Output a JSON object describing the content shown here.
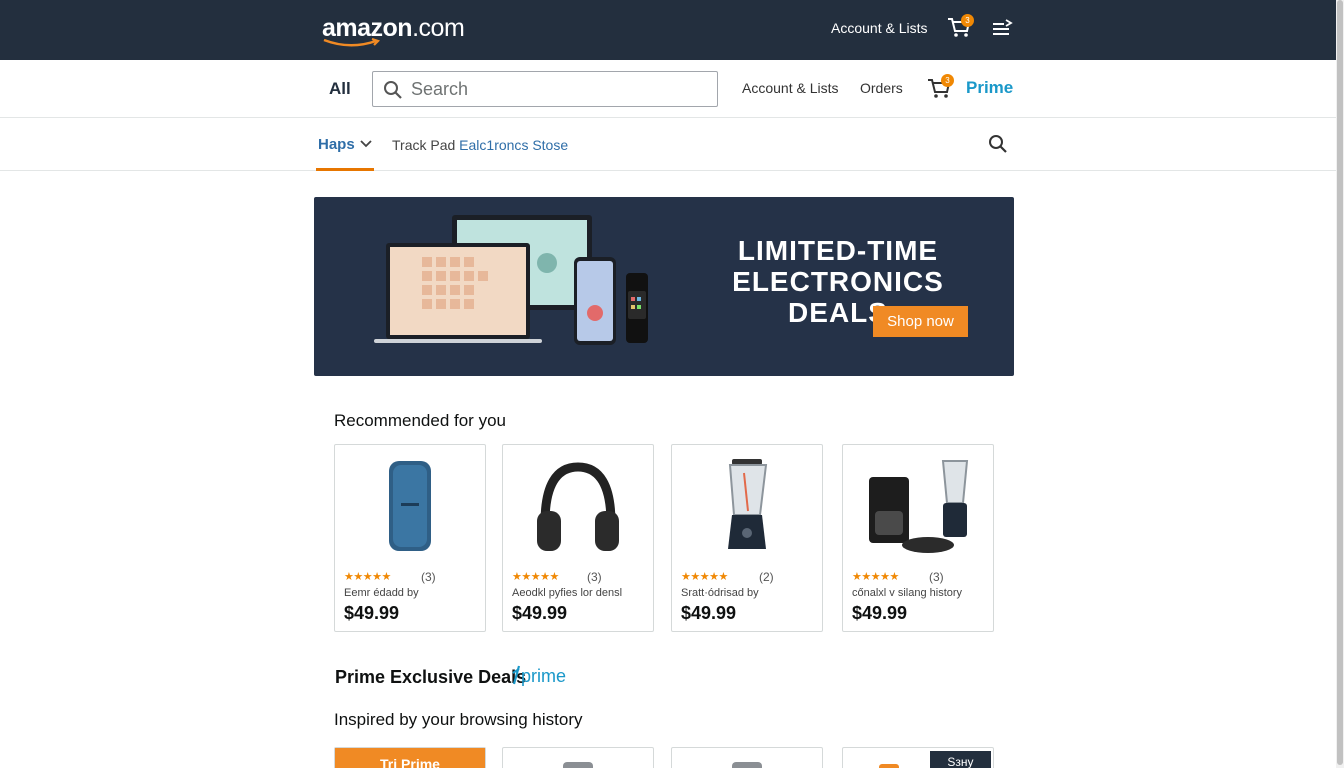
{
  "header": {
    "logo_main": "amazon",
    "logo_suffix": ".com",
    "account_label": "Account & Lists",
    "cart_count": "3",
    "menu_icon": "menu-arrow-icon"
  },
  "search_bar": {
    "all_label": "All",
    "placeholder": "Search",
    "value": "",
    "account_label": "Account & Lists",
    "orders_label": "Orders",
    "cart_count": "3",
    "prime_label": "Prime"
  },
  "subnav": {
    "home_label": "Haps",
    "store_prefix": "Track Pad ",
    "store_highlight": "Ealc1ronc",
    "store_suffix": "s Stose"
  },
  "banner": {
    "title_line1": "LIMITED-TIME",
    "title_line2": "ELECTRONICS DEALS",
    "cta_label": "Shop now"
  },
  "recommended": {
    "title": "Recommended for you",
    "items": [
      {
        "stars": "★★★★★",
        "rating": 4.5,
        "count": "(3)",
        "desc": "Eemr édadd by",
        "price": "$49.99",
        "icon": "speaker-icon"
      },
      {
        "stars": "★★★★★",
        "rating": 5,
        "count": "(3)",
        "desc": "Aeodkl pyfies lor densl",
        "price": "$49.99",
        "icon": "headphones-icon"
      },
      {
        "stars": "★★★★★",
        "rating": 4.5,
        "count": "(2)",
        "desc": "Sratt·ódrisad by",
        "price": "$49.99",
        "icon": "blender-icon"
      },
      {
        "stars": "★★★★★",
        "rating": 5,
        "count": "(3)",
        "desc": "cőnalxl v silang history",
        "price": "$49.99",
        "icon": "coffee-maker-icon"
      }
    ]
  },
  "prime_deals": {
    "title": "Prime Exclusive Deals",
    "logo_text": "prime"
  },
  "inspired": {
    "title": "Inspired by your browsing history",
    "try_prime_label": "Tri Prime",
    "tag_label": "Sзну"
  },
  "colors": {
    "header_bg": "#232f3e",
    "accent_orange": "#f08a24",
    "prime_blue": "#1a98c9",
    "link_blue": "#2f6ea8"
  }
}
